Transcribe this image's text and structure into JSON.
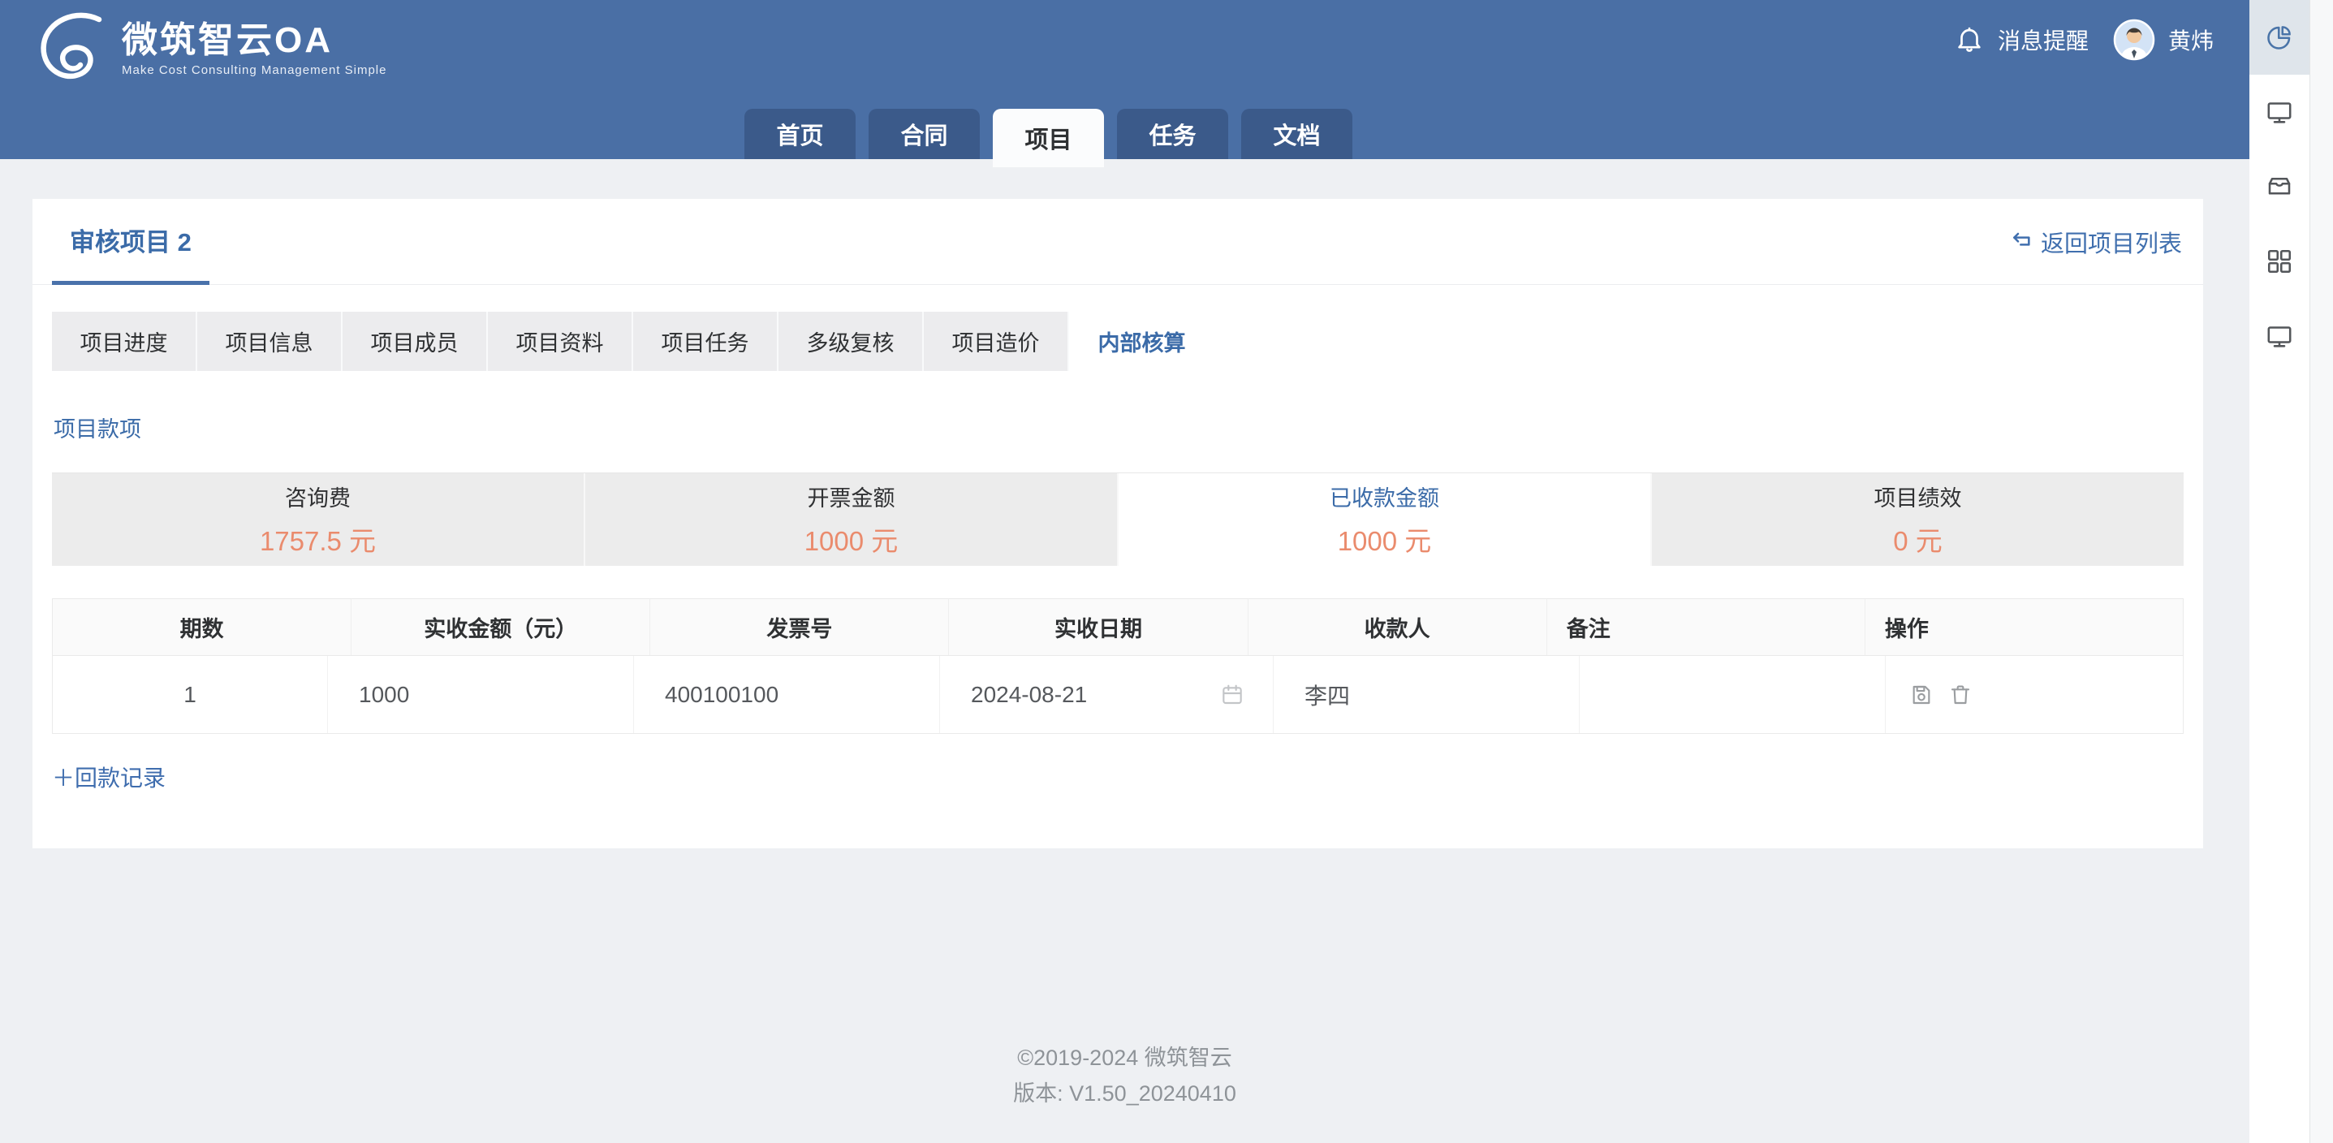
{
  "colors": {
    "header_bg": "#4a6fa5",
    "nav_tab_inactive_bg": "#3b5a8a",
    "accent_blue": "#3b6ba8",
    "value_orange": "#ea8b6d",
    "page_bg": "#eef0f3",
    "stat_card_gray": "#ececec"
  },
  "brand": {
    "name": "微筑智云OA",
    "tagline": "Make Cost Consulting Management Simple"
  },
  "header": {
    "notifications_label": "消息提醒",
    "username": "黄炜",
    "nav_tabs": [
      {
        "label": "首页",
        "active": false
      },
      {
        "label": "合同",
        "active": false
      },
      {
        "label": "项目",
        "active": true
      },
      {
        "label": "任务",
        "active": false
      },
      {
        "label": "文档",
        "active": false
      }
    ]
  },
  "sidebar": {
    "items": [
      {
        "icon": "pie-chart-icon",
        "active": true
      },
      {
        "icon": "monitor-icon",
        "active": false
      },
      {
        "icon": "inbox-icon",
        "active": false
      },
      {
        "icon": "grid-icon",
        "active": false
      },
      {
        "icon": "monitor-icon",
        "active": false
      }
    ]
  },
  "page": {
    "title": "审核项目 2",
    "back_link": "返回项目列表",
    "tabs": [
      {
        "label": "项目进度",
        "active": false
      },
      {
        "label": "项目信息",
        "active": false
      },
      {
        "label": "项目成员",
        "active": false
      },
      {
        "label": "项目资料",
        "active": false
      },
      {
        "label": "项目任务",
        "active": false
      },
      {
        "label": "多级复核",
        "active": false
      },
      {
        "label": "项目造价",
        "active": false
      },
      {
        "label": "内部核算",
        "active": true
      }
    ],
    "section_title": "项目款项",
    "stat_cards": [
      {
        "label": "咨询费",
        "value": "1757.5 元",
        "active": false
      },
      {
        "label": "开票金额",
        "value": "1000 元",
        "active": false
      },
      {
        "label": "已收款金额",
        "value": "1000 元",
        "active": true
      },
      {
        "label": "项目绩效",
        "value": "0 元",
        "active": false
      }
    ],
    "table": {
      "columns": [
        "期数",
        "实收金额（元）",
        "发票号",
        "实收日期",
        "收款人",
        "备注",
        "操作"
      ],
      "rows": [
        {
          "period": "1",
          "amount": "1000",
          "invoice_no": "400100100",
          "date": "2024-08-21",
          "payee": "李四",
          "remark": ""
        }
      ]
    },
    "add_record": {
      "plus": "＋",
      "label": "回款记录"
    }
  },
  "footer": {
    "copyright": "©2019-2024 微筑智云",
    "version": "版本: V1.50_20240410"
  }
}
